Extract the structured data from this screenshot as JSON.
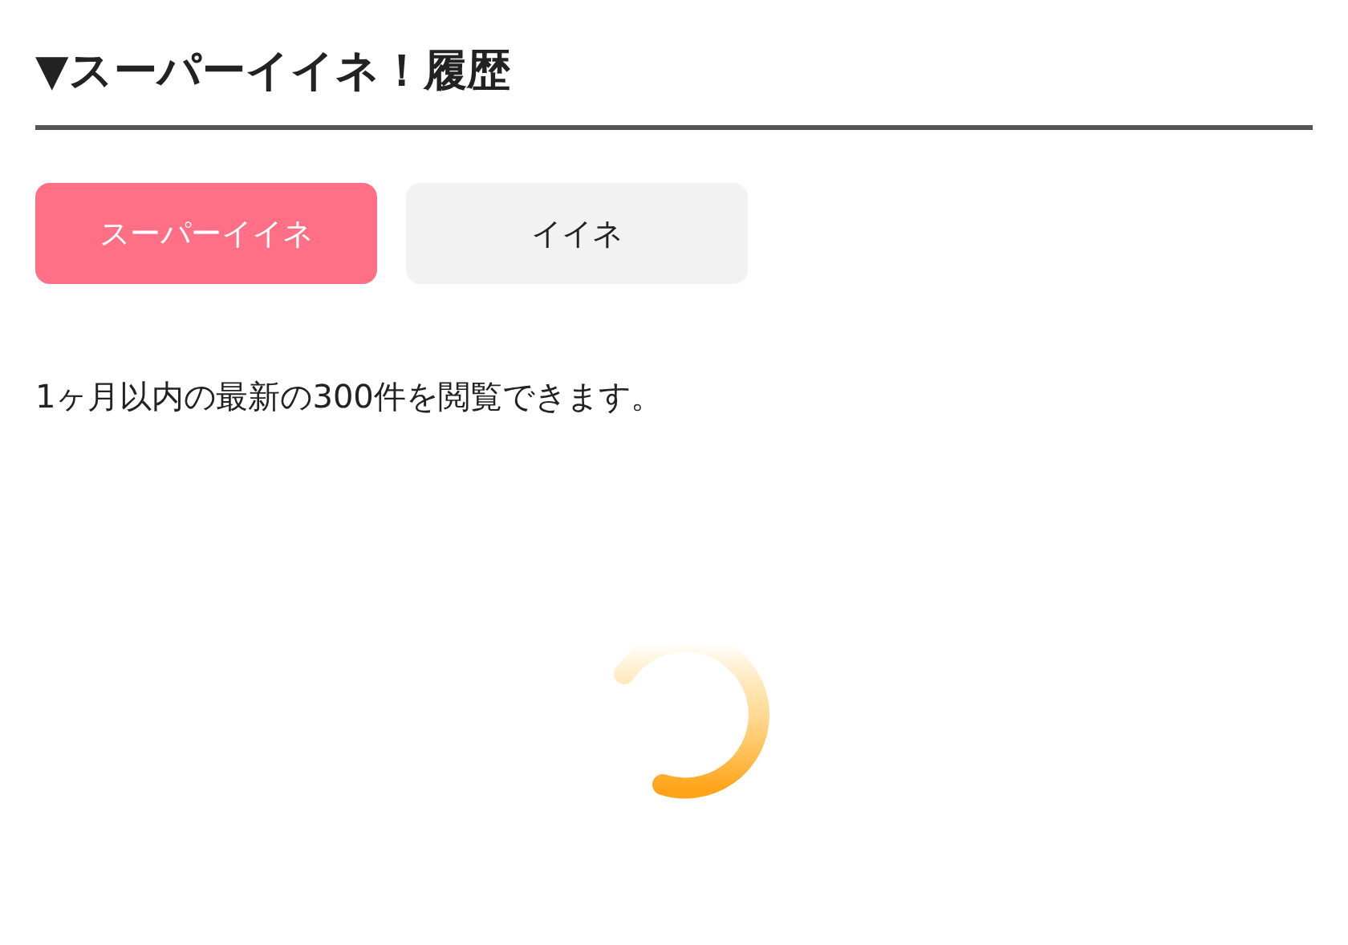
{
  "heading": {
    "title": "▼スーパーイイネ！履歴"
  },
  "tabs": [
    {
      "label": "スーパーイイネ",
      "selected": true
    },
    {
      "label": "イイネ",
      "selected": false
    }
  ],
  "notice": "1ヶ月以内の最新の300件を閲覧できます。",
  "loading": true
}
